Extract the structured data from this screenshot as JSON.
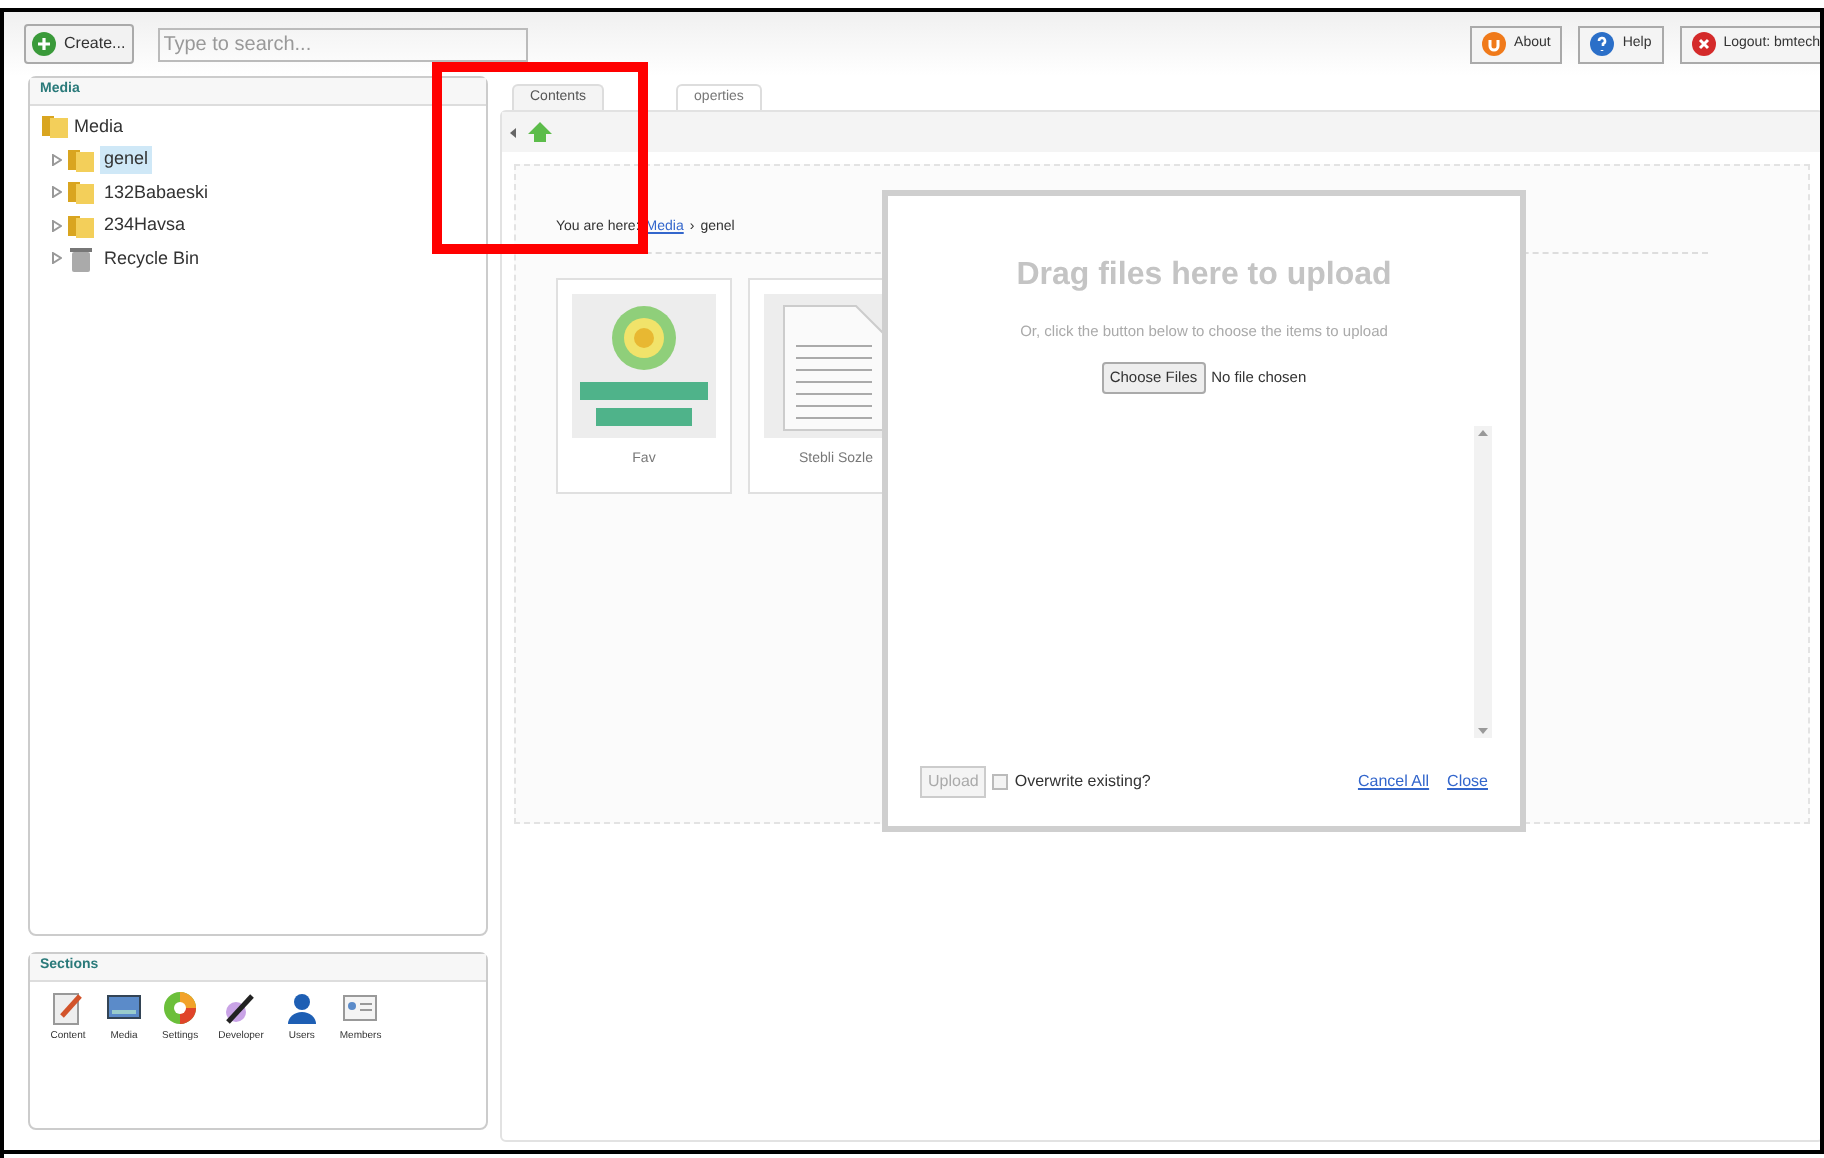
{
  "toolbar": {
    "create_button": "Create...",
    "search": {
      "placeholder": "Type to search..."
    },
    "buttons": [
      {
        "kind": "about",
        "label": "About"
      },
      {
        "kind": "help",
        "label": "Help"
      },
      {
        "kind": "logout",
        "label": "Logout: bmtech"
      }
    ]
  },
  "tree": {
    "title": "Media",
    "root": {
      "label": "Media",
      "kind": "folder",
      "children": [
        {
          "label": "genel",
          "kind": "folder",
          "selected": true
        },
        {
          "label": "132Babaeski",
          "kind": "folder",
          "selected": false
        },
        {
          "label": "234Havsa",
          "kind": "folder",
          "selected": false
        },
        {
          "label": "Recycle Bin",
          "kind": "bin",
          "selected": false
        }
      ]
    }
  },
  "sections": {
    "title": "Sections",
    "items": [
      {
        "kind": "content",
        "label": "Content"
      },
      {
        "kind": "media",
        "label": "Media"
      },
      {
        "kind": "settings",
        "label": "Settings"
      },
      {
        "kind": "developer",
        "label": "Developer"
      },
      {
        "kind": "users",
        "label": "Users"
      },
      {
        "kind": "members",
        "label": "Members"
      }
    ]
  },
  "tabs": [
    {
      "label": "Contents",
      "selected": true
    },
    {
      "label": "operties",
      "selected": false
    }
  ],
  "breadcrumb": {
    "prefix": "You are here:",
    "link": "Media",
    "separator": "›",
    "current": "genel"
  },
  "items": [
    {
      "label": "Fav"
    },
    {
      "kind": "document",
      "label": "Stebli Sozle"
    }
  ],
  "upload_dialog": {
    "title": "Drag files here to upload",
    "hint": "Or, click the button below to choose the items to upload",
    "choose_button": "Choose Files",
    "file_status": "No file chosen",
    "upload_button": {
      "label": "Upload",
      "disabled": true
    },
    "overwrite": {
      "label": "Overwrite existing?",
      "checked": false
    },
    "links": [
      "Cancel All",
      "Close"
    ]
  }
}
